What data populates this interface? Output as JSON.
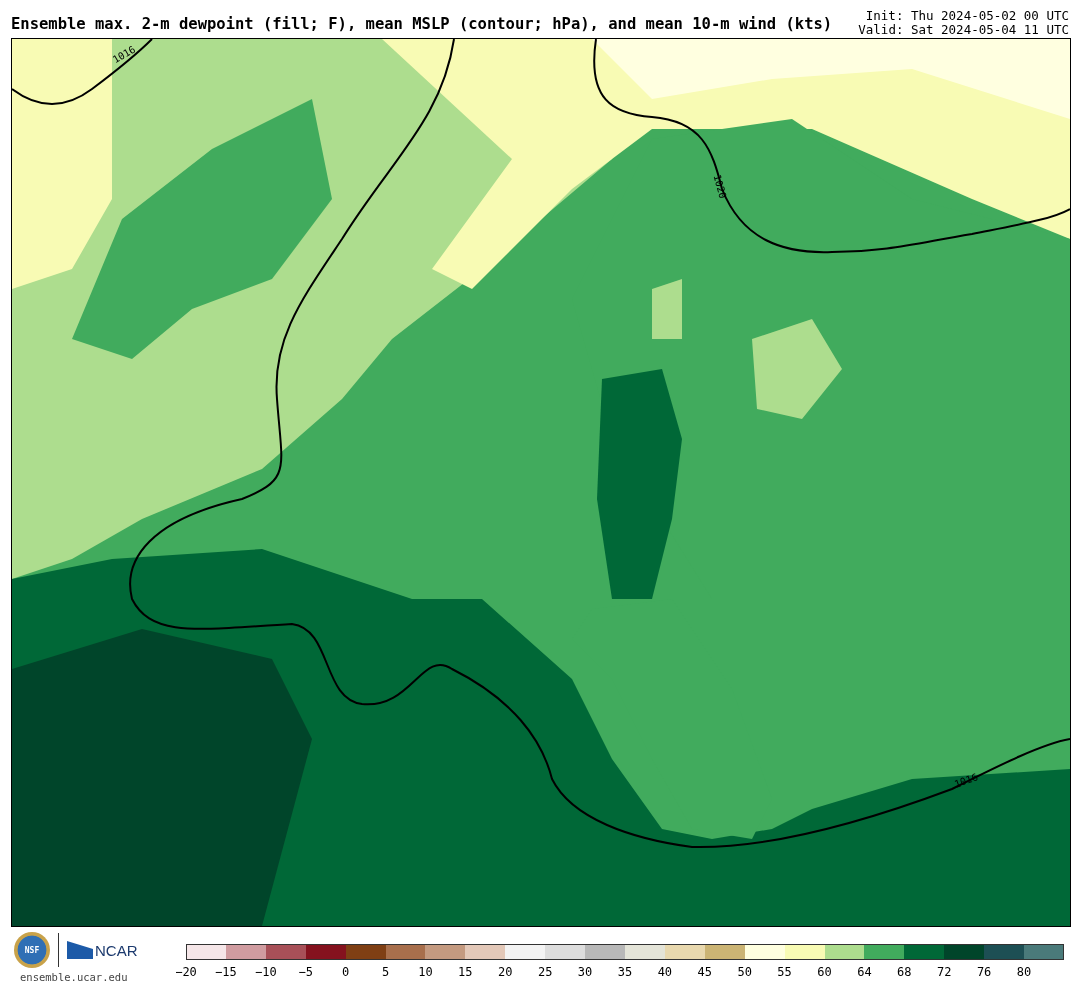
{
  "header": {
    "title": "Ensemble max. 2-m dewpoint (fill; F), mean MSLP (contour; hPa), and mean 10-m wind (kts)",
    "init": "Init: Thu 2024-05-02 00 UTC",
    "valid": "Valid: Sat 2024-05-04 11 UTC"
  },
  "map": {
    "contour_labels": [
      "1016",
      "1020",
      "1016"
    ]
  },
  "footer": {
    "logos": [
      {
        "kind": "nsf",
        "text": "NSF"
      },
      {
        "kind": "ncar",
        "text": "NCAR"
      }
    ],
    "site": "ensemble.ucar.edu"
  },
  "colorbar": {
    "segments": [
      {
        "color": "#f5e6e8",
        "label": "−20"
      },
      {
        "color": "#d09ca0",
        "label": "−15"
      },
      {
        "color": "#a85058",
        "label": "−10"
      },
      {
        "color": "#85121e",
        "label": "−5"
      },
      {
        "color": "#7f3f14",
        "label": "0"
      },
      {
        "color": "#a86f4c",
        "label": "5"
      },
      {
        "color": "#c49a80",
        "label": "10"
      },
      {
        "color": "#e3c8b8",
        "label": "15"
      },
      {
        "color": "#f3f3f3",
        "label": "20"
      },
      {
        "color": "#dddddd",
        "label": "25"
      },
      {
        "color": "#b8b8b8",
        "label": "30"
      },
      {
        "color": "#e4e4d8",
        "label": "35"
      },
      {
        "color": "#e8d8ae",
        "label": "40"
      },
      {
        "color": "#cbb474",
        "label": "45"
      },
      {
        "color": "#ffffe0",
        "label": "50"
      },
      {
        "color": "#f8fbb4",
        "label": "55"
      },
      {
        "color": "#addd8e",
        "label": "60"
      },
      {
        "color": "#41ab5d",
        "label": "64"
      },
      {
        "color": "#006837",
        "label": "68"
      },
      {
        "color": "#00452a",
        "label": "72"
      },
      {
        "color": "#1d4f54",
        "label": "76"
      },
      {
        "color": "#4a7a7a",
        "label": "80"
      }
    ]
  }
}
